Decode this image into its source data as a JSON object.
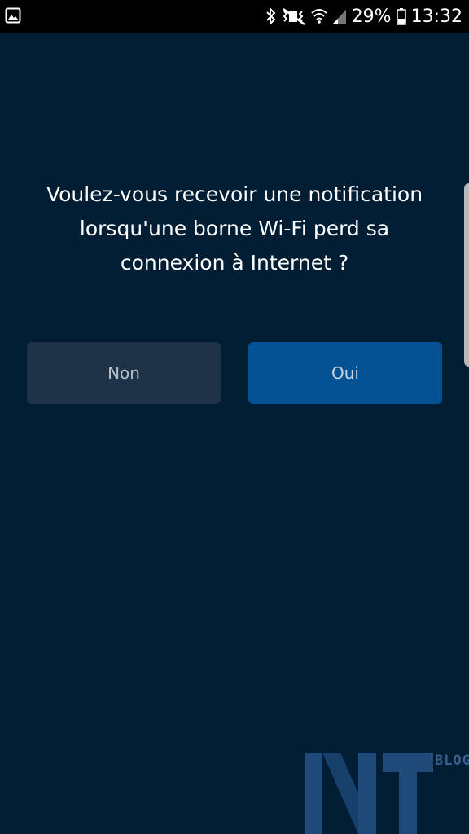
{
  "status_bar": {
    "gallery_icon": "image-icon",
    "bluetooth_icon": "bluetooth-icon",
    "mute_icon": "vibrate-mute-icon",
    "wifi_icon": "wifi-icon",
    "signal_icon": "signal-icon",
    "battery_icon": "battery-icon",
    "battery_percent": "29%",
    "time": "13:32"
  },
  "dialog": {
    "question_line1": "Voulez-vous recevoir une notification",
    "question_line2": "lorsqu'une borne Wi-Fi perd sa",
    "question_line3": "connexion à Internet ?",
    "no_label": "Non",
    "yes_label": "Oui"
  },
  "watermark": {
    "logo": "NT",
    "tag": "BLOG"
  },
  "colors": {
    "background": "#011e34",
    "no_button": "#1f3348",
    "yes_button": "#045293",
    "watermark": "#1f4a7a"
  }
}
